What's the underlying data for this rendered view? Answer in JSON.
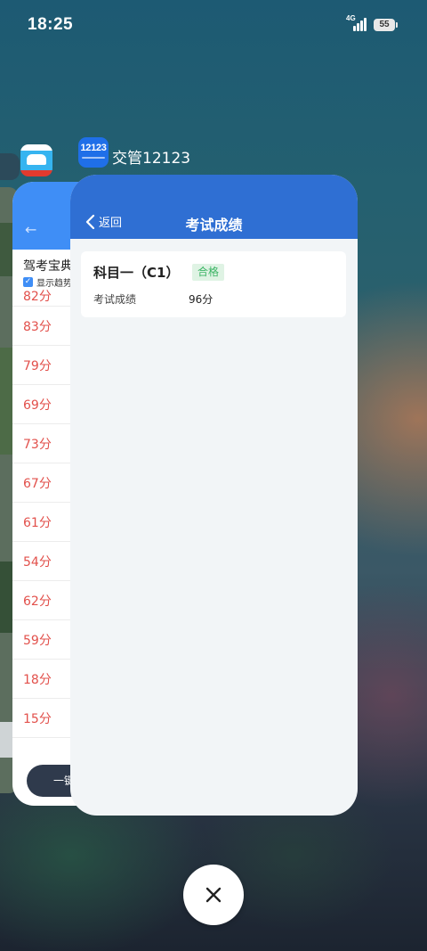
{
  "status_bar": {
    "time": "18:25",
    "network": "4G",
    "battery": "55"
  },
  "left_ghost_card": {},
  "middle_app": {
    "title_partial": "驾考宝典",
    "checkbox_label": "显示趋势",
    "scores": [
      "82分",
      "83分",
      "79分",
      "69分",
      "73分",
      "67分",
      "61分",
      "54分",
      "62分",
      "59分",
      "18分",
      "15分"
    ],
    "bottom_button": "一键"
  },
  "front_app": {
    "name": "交管12123",
    "icon_text": "12123",
    "back_label": "返回",
    "page_title": "考试成绩",
    "result": {
      "subject": "科目一（C1）",
      "status": "合格",
      "score_label": "考试成绩",
      "score_value": "96分"
    }
  },
  "colors": {
    "front_header": "#2f6fd3",
    "score_red": "#e2504b",
    "pass_green": "#3cb465",
    "pass_bg": "#dff3e4"
  }
}
